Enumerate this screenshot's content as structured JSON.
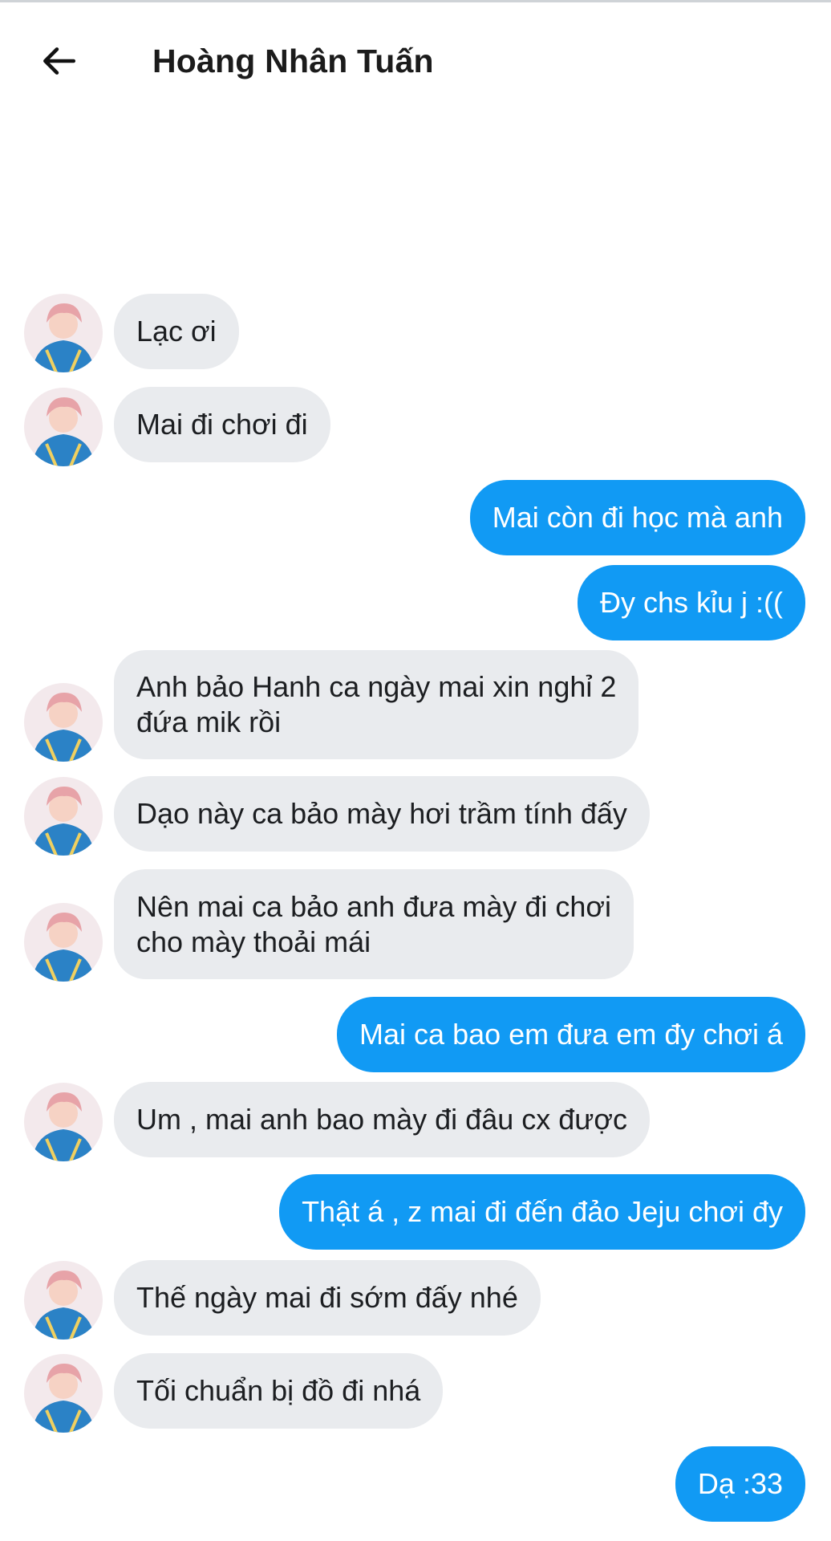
{
  "header": {
    "title": "Hoàng Nhân Tuấn",
    "back_icon": "arrow-left-icon"
  },
  "colors": {
    "sent_bubble": "#119af4",
    "received_bubble": "#e9ebee"
  },
  "messages": [
    {
      "sender": "them",
      "text": "Lạc ơi"
    },
    {
      "sender": "them",
      "text": "Mai đi chơi đi"
    },
    {
      "sender": "me",
      "text": "Mai còn đi học mà anh"
    },
    {
      "sender": "me",
      "text": "Đy chs kỉu j :(("
    },
    {
      "sender": "them",
      "text": "Anh bảo Hanh ca ngày mai xin nghỉ 2\nđứa mik rồi"
    },
    {
      "sender": "them",
      "text": "Dạo này ca bảo mày hơi trầm tính đấy"
    },
    {
      "sender": "them",
      "text": "Nên mai ca bảo anh đưa mày đi chơi\ncho mày thoải mái"
    },
    {
      "sender": "me",
      "text": "Mai ca bao em đưa em đy chơi á"
    },
    {
      "sender": "them",
      "text": "Um , mai anh bao mày đi đâu cx được"
    },
    {
      "sender": "me",
      "text": "Thật á , z mai đi đến đảo Jeju chơi đy"
    },
    {
      "sender": "them",
      "text": "Thế ngày mai đi sớm đấy nhé"
    },
    {
      "sender": "them",
      "text": "Tối chuẩn bị đồ đi nhá"
    },
    {
      "sender": "me",
      "text": "Dạ :33"
    }
  ]
}
